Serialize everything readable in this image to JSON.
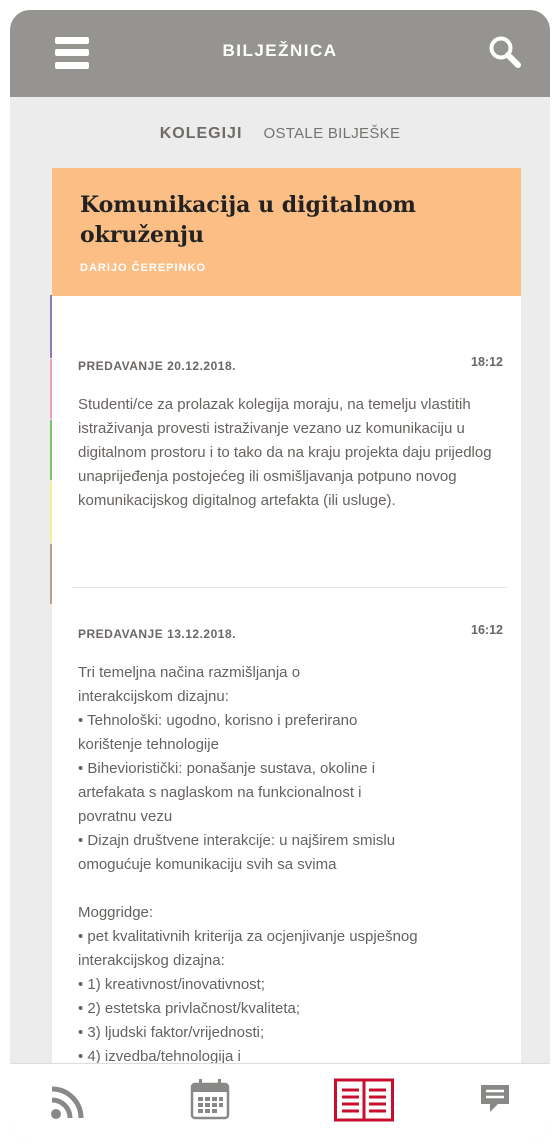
{
  "header": {
    "title": "BILJEŽNICA"
  },
  "tabs": [
    {
      "label": "KOLEGIJI"
    },
    {
      "label": "OSTALE BILJEŠKE"
    }
  ],
  "course": {
    "title": "Komunikacija u digitalnom okruženju",
    "lecturer": "DARIJO ČEREPINKO",
    "color": "#fbbe85"
  },
  "notes": [
    {
      "label": "PREDAVANJE 20.12.2018.",
      "time": "18:12",
      "body": "Studenti/ce za prolazak kolegija moraju, na temelju vlastitih istraživanja provesti istraživanje vezano uz komunikaciju u digitalnom prostoru i to tako da na kraju projekta daju prijedlog unaprijeđenja postojećeg ili osmišljavanja potpuno novog komunikacijskog digitalnog artefakta (ili usluge)."
    },
    {
      "label": "PREDAVANJE 13.12.2018.",
      "time": "16:12",
      "body": "Tri temeljna načina razmišljanja o\ninterakcijskom dizajnu:\n• Tehnološki: ugodno, korisno i preferirano\nkorištenje tehnologije\n• Bihevioristički: ponašanje sustava, okoline i\nartefakata s naglaskom na funkcionalnost i\npovratnu vezu\n• Dizajn društvene interakcije: u najširem smislu\nomogućuje komunikaciju svih sa svima\n\nMoggridge:\n• pet kvalitativnih kriterija za ocjenjivanje uspješnog\ninterakcijskog dizajna:\n• 1) kreativnost/inovativnost;\n• 2) estetska privlačnost/kvaliteta;\n• 3) ljudski faktor/vrijednosti;\n• 4) izvedba/tehnologija i"
    }
  ],
  "side_colors": [
    "#8c7bb6",
    "#e9a3b8",
    "#7cc46e",
    "#f4ee94",
    "#b8a08c"
  ],
  "bottom_nav": [
    {
      "icon": "rss-icon"
    },
    {
      "icon": "calendar-icon"
    },
    {
      "icon": "notebook-icon",
      "active": true,
      "color": "#c8102e"
    },
    {
      "icon": "chat-icon"
    }
  ]
}
